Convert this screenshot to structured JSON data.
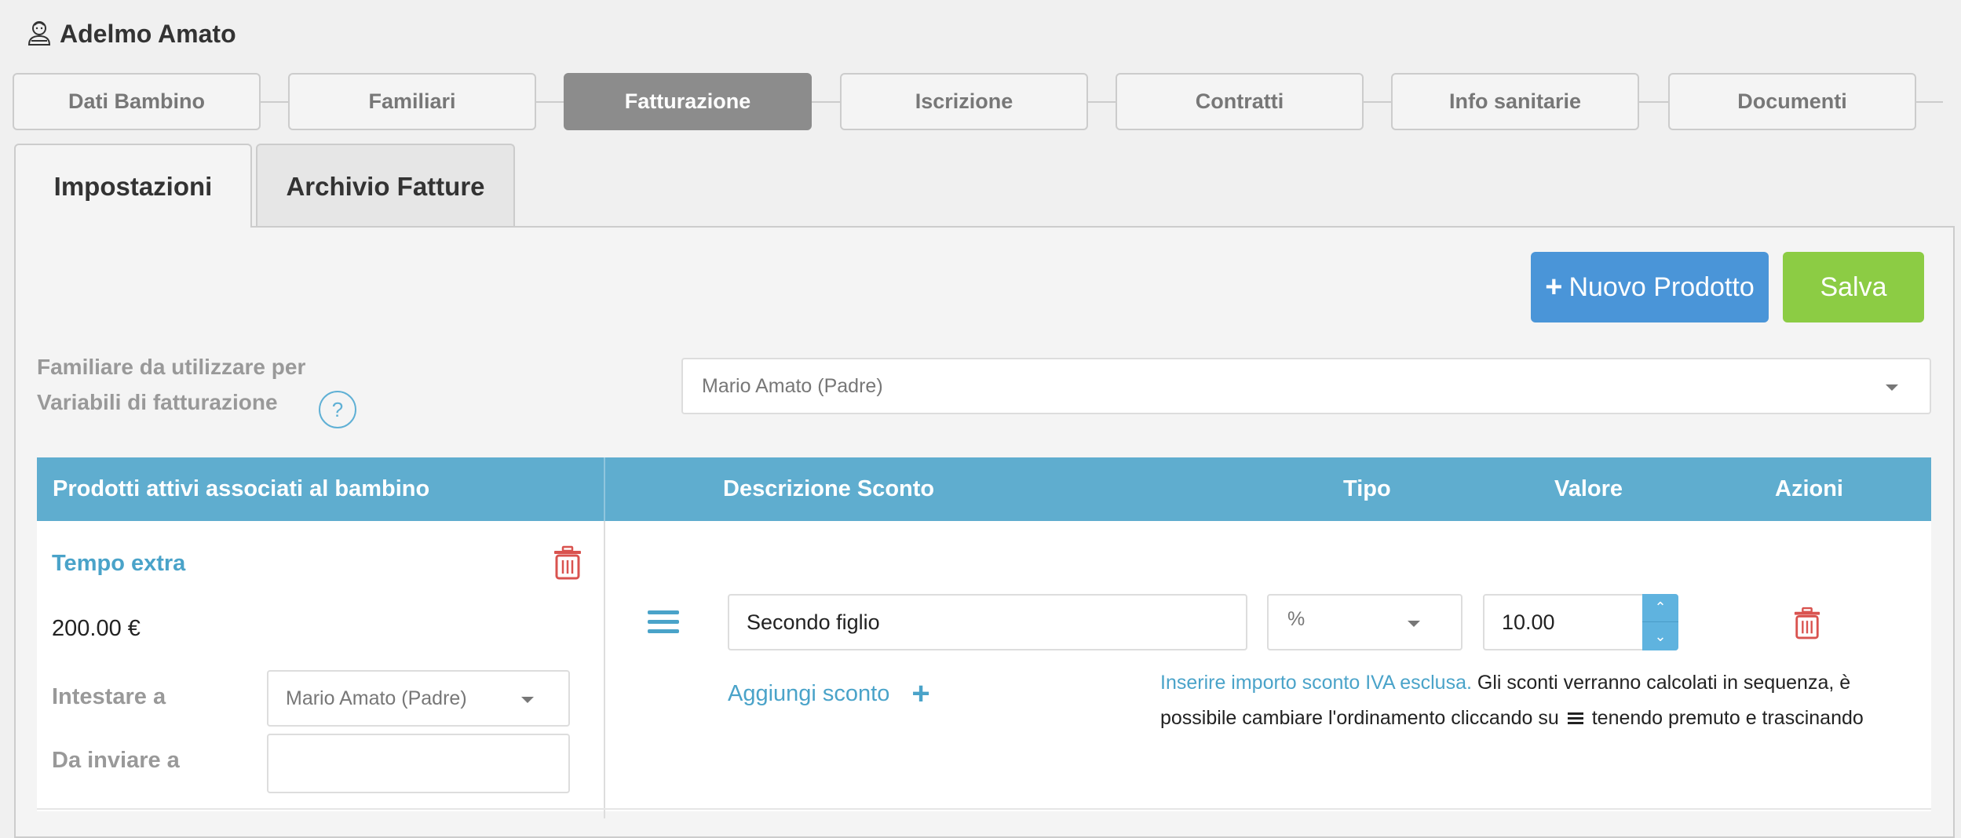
{
  "child": {
    "name": "Adelmo Amato",
    "icon": "child-face-icon"
  },
  "steps": [
    "Dati Bambino",
    "Familiari",
    "Fatturazione",
    "Iscrizione",
    "Contratti",
    "Info sanitarie",
    "Documenti"
  ],
  "active_step": "Fatturazione",
  "subtabs": [
    "Impostazioni",
    "Archivio Fatture"
  ],
  "active_subtab": "Impostazioni",
  "toolbar": {
    "new_product_label": "Nuovo Prodotto",
    "save_label": "Salva"
  },
  "billing_family": {
    "label_line1": "Familiare da utilizzare per",
    "label_line2": "Variabili di fatturazione",
    "help": "?",
    "selected": "Mario Amato (Padre)"
  },
  "table": {
    "headers": {
      "products": "Prodotti attivi associati al bambino",
      "discount_desc": "Descrizione Sconto",
      "type": "Tipo",
      "value": "Valore",
      "actions": "Azioni"
    },
    "product": {
      "name": "Tempo extra",
      "price": "200.00 €",
      "bill_to_label": "Intestare a",
      "bill_to_value": "Mario Amato (Padre)",
      "send_to_label": "Da inviare a",
      "send_to_value": ""
    },
    "discount": {
      "description": "Secondo figlio",
      "type": "%",
      "value": "10.00"
    },
    "add_discount_label": "Aggiungi sconto",
    "info_blue": "Inserire importo sconto IVA esclusa.",
    "info_text_1": "Gli sconti verranno calcolati in sequenza, è",
    "info_text_2": "possibile cambiare l'ordinamento cliccando su",
    "info_text_3": "tenendo premuto e trascinando"
  },
  "colors": {
    "header_blue": "#5fadcf",
    "link_blue": "#4aa3c9",
    "new_button": "#4a95d8",
    "save_button": "#8ccc44",
    "delete_red": "#d9534f",
    "active_step": "#8c8c8c"
  }
}
